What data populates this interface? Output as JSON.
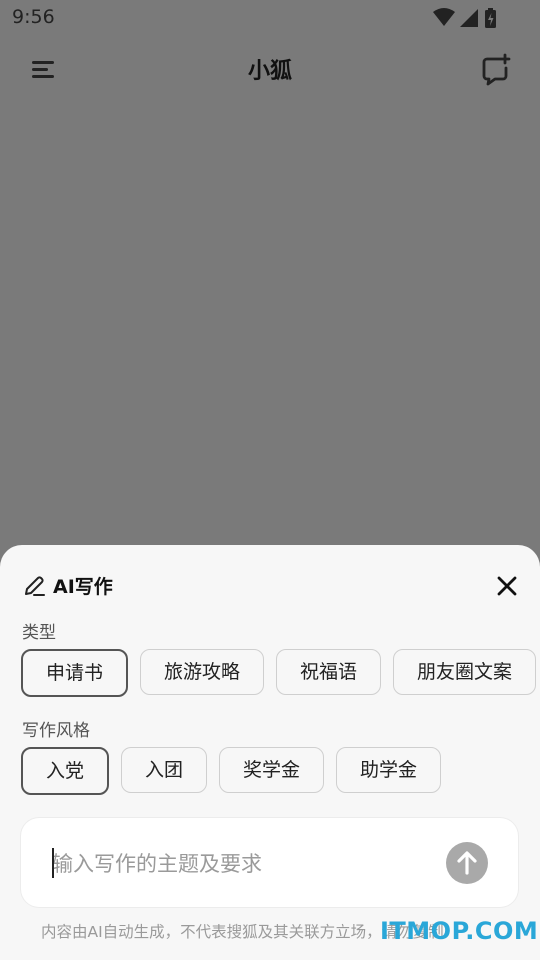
{
  "status_bar": {
    "time": "9:56",
    "icons": [
      "wifi-icon",
      "signal-icon",
      "battery-charging-icon"
    ]
  },
  "top_bar": {
    "title": "小狐",
    "menu_icon": "menu-icon",
    "new_chat_icon": "new-chat-icon"
  },
  "sheet": {
    "title": "AI写作",
    "title_icon": "pen-icon",
    "close_icon": "close-icon",
    "type_section": {
      "label": "类型",
      "chips": [
        "申请书",
        "旅游攻略",
        "祝福语",
        "朋友圈文案"
      ],
      "selected_index": 0
    },
    "style_section": {
      "label": "写作风格",
      "chips": [
        "入党",
        "入团",
        "奖学金",
        "助学金"
      ],
      "selected_index": 0
    },
    "input": {
      "placeholder": "输入写作的主题及要求",
      "send_icon": "arrow-up-icon"
    },
    "disclaimer": "内容由AI自动生成，不代表搜狐及其关联方立场，请勿复制",
    "watermark": "ITMOP.COM"
  }
}
